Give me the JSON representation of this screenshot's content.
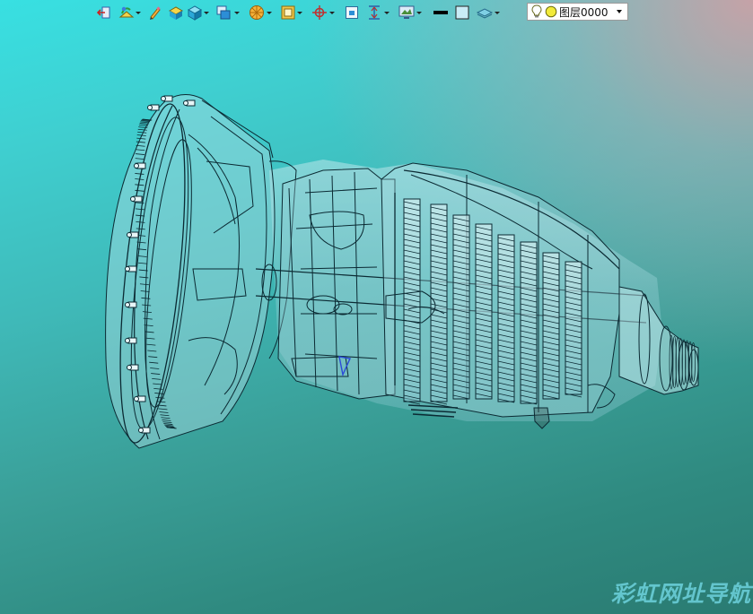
{
  "toolbar": {
    "buttons": [
      {
        "name": "exit-sketch-icon",
        "dropdown": false
      },
      {
        "name": "sketch-tool-icon",
        "dropdown": true
      },
      {
        "name": "pencil-icon",
        "dropdown": false
      },
      {
        "name": "extrude-solid-icon",
        "dropdown": false
      },
      {
        "name": "box-solid-icon",
        "dropdown": true
      },
      {
        "name": "view-cube-icon",
        "dropdown": true
      },
      {
        "name": "render-style-icon",
        "dropdown": true
      },
      {
        "name": "wireframe-box-icon",
        "dropdown": true
      },
      {
        "name": "origin-axis-icon",
        "dropdown": true
      },
      {
        "name": "plane-icon",
        "dropdown": false
      },
      {
        "name": "dimension-icon",
        "dropdown": true
      },
      {
        "name": "display-icon",
        "dropdown": true
      },
      {
        "name": "line-style-icon",
        "dropdown": false
      },
      {
        "name": "fill-color-icon",
        "dropdown": false
      },
      {
        "name": "layer-visibility-icon",
        "dropdown": true
      }
    ],
    "layer_select": {
      "value": "图层0000",
      "icons": [
        "lightbulb-icon",
        "layer-color-icon"
      ]
    }
  },
  "viewport": {
    "description_colors": {
      "top_left": "#38e0e2",
      "bottom": "#2a7b72",
      "top_right": "#c9a0a4"
    }
  },
  "model": {
    "name": "transmission-assembly",
    "line_color": "#0b2a33",
    "fill_color": "#9fd6dc"
  },
  "watermark": "彩虹网址导航"
}
